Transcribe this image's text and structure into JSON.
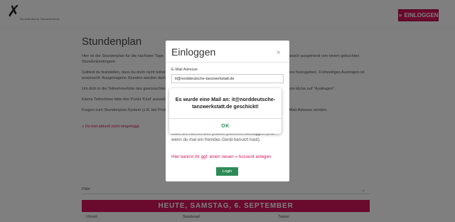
{
  "header": {
    "logo_text": "Norddeutsche Tanzwerkstatt",
    "login_button": "EINLOGGEN"
  },
  "main": {
    "title": "Stundenplan",
    "paragraphs": [
      "Hier ist der Stundenplan für die nächsten Tage. Die Buchung ist bis jeweils zum Vortag 20:00 Uhr möglich, für heute danach ausgehend von einem gebuchten Stundenkontingent.",
      "Solltest du feststellen, dass du doch nicht teilnehmen kannst, kannst du dich wieder austragen, um die Stunde für andere freizugeben. Frühzeitiges Austragen ist erwünscht. Ausgetragene Stunden werden dem Kontingent wieder gutgeschrieben.",
      "Um dich in die Teilnehmerliste des gewünschten Kurses einzutragen, klicke auf \"Eintragen\". Zum Austragen aus der Liste klicke auf \"Austragen\".",
      "Kleine Teilnehmer bitte den Punkt 'Kind' auswählen. Maximale Teilnehmer beachten.",
      "Fragen zum Stundenplan-System (z.B. bei Problemen mit dem Login) kannst du an die im Impressum angegebene E-Mail-Adresse senden."
    ],
    "help_link": "» Du bist aktuell nicht eingeloggt",
    "filter_label": "Filter",
    "day_banner": "HEUTE, SAMSTAG, 6. SEPTEMBER",
    "table_headers": [
      "Uhrzeit",
      "Stundenart",
      "Trainer"
    ]
  },
  "modal": {
    "title": "Einloggen",
    "close_symbol": "×",
    "email_label": "E-Mail Adresse",
    "email_value": "it@norddeutsche-tanzwerkstatt.de",
    "text": "statt. Du kannst dich jedoch jederzeit austoggen (z.B. wenn du mal ein fremdes Gerät benutzt hast).",
    "account_prefix": "Hier kannst ihr ggf. einen neuen ",
    "account_link": "» Account anlegen",
    "login_button": "Login"
  },
  "alert": {
    "message": "Es wurde eine Mail an: it@norddeutsche-tanzwerkstatt.de geschickt!",
    "ok_label": "OK"
  }
}
